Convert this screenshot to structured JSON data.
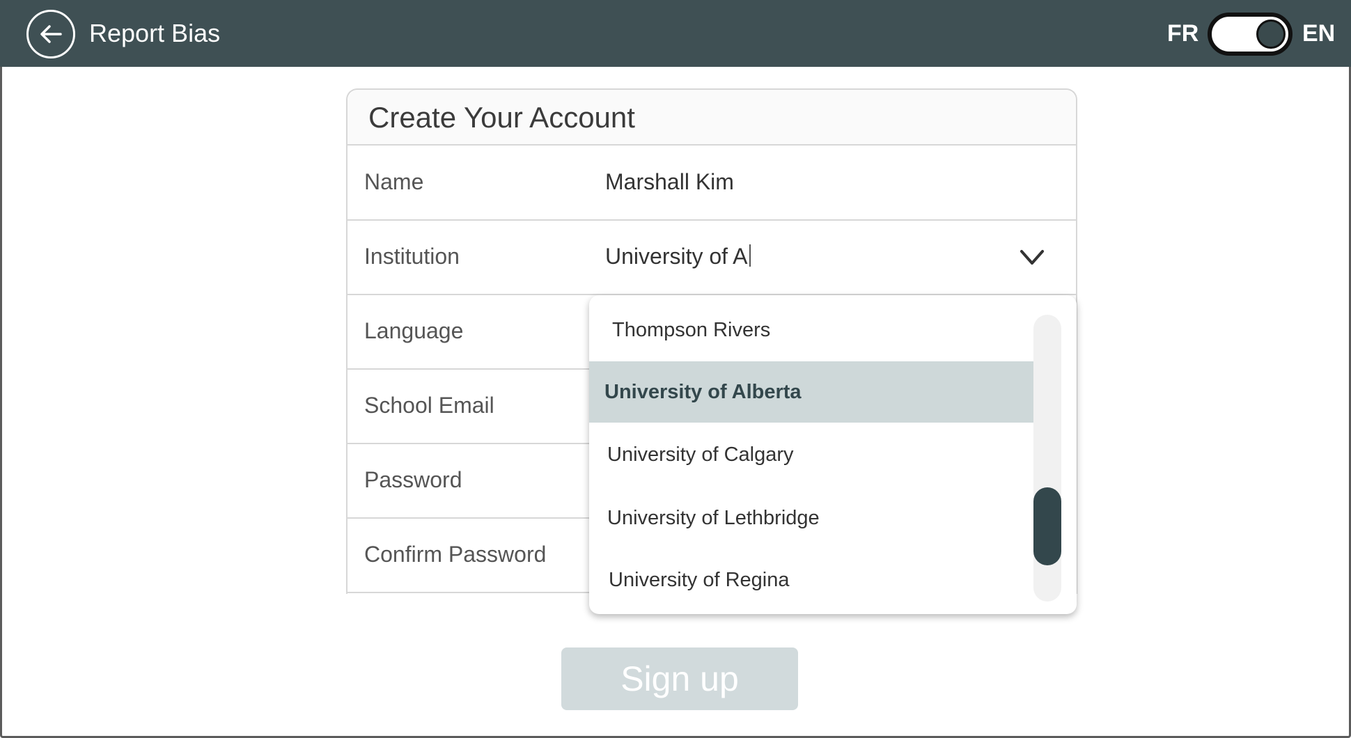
{
  "header": {
    "title": "Report Bias",
    "lang_left": "FR",
    "lang_right": "EN",
    "toggle_state": "EN",
    "bg_color": "#3f5054"
  },
  "form": {
    "title": "Create Your Account",
    "fields": [
      {
        "label": "Name",
        "value": "Marshall Kim"
      },
      {
        "label": "Institution",
        "value": "University of A"
      },
      {
        "label": "Language",
        "value": ""
      },
      {
        "label": "School Email",
        "value": ""
      },
      {
        "label": "Password",
        "value": ""
      },
      {
        "label": "Confirm Password",
        "value": ""
      }
    ]
  },
  "dropdown": {
    "options": [
      "Thompson Rivers",
      "University of Alberta",
      "University of Calgary",
      "University of Lethbridge",
      "University of Regina"
    ],
    "selected": "University of Alberta",
    "highlight_color": "#ced8d9",
    "scroll_position": 0.9
  },
  "submit": {
    "label": "Sign up",
    "state": "disabled"
  },
  "icons": {
    "back": "back-arrow-icon",
    "dropdown": "chevron-down-icon"
  }
}
